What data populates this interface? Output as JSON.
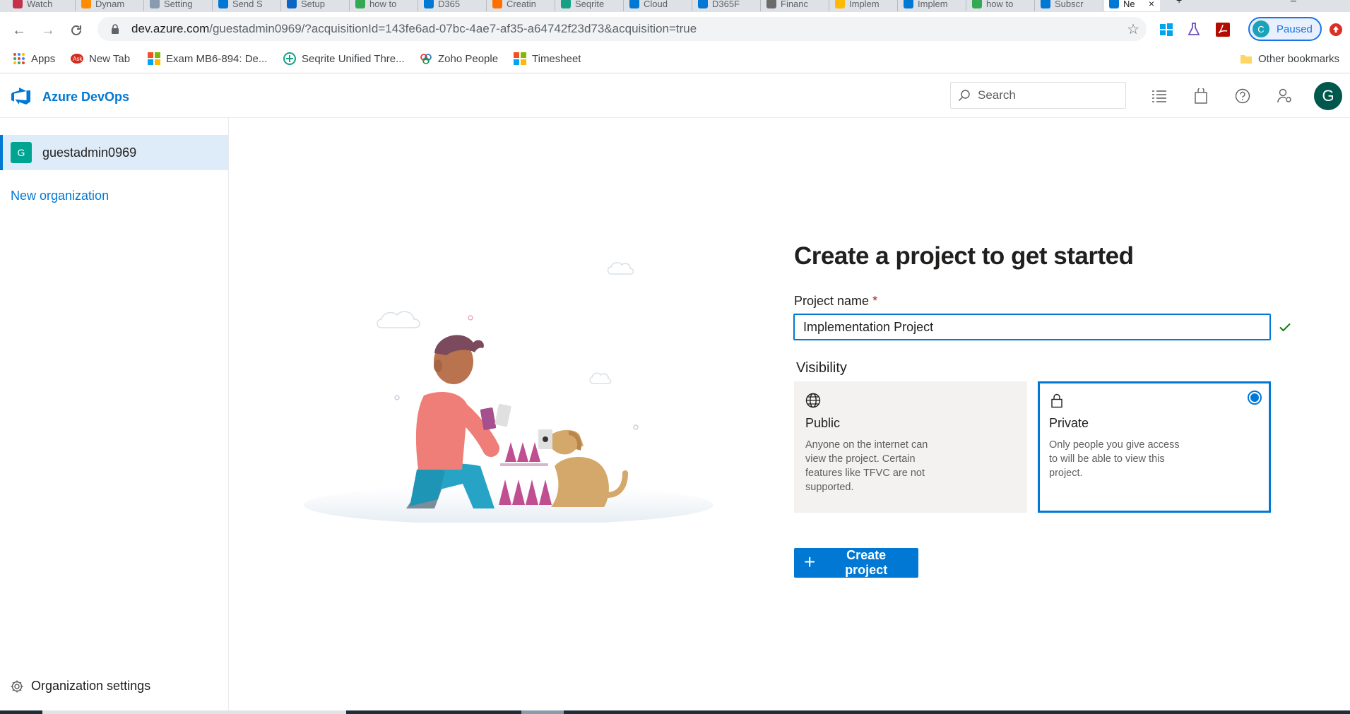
{
  "browser": {
    "tabs": [
      {
        "label": "Watch",
        "color": "#c4314b"
      },
      {
        "label": "Dynam",
        "color": "#ff8c00"
      },
      {
        "label": "Setting",
        "color": "#8a9bb0"
      },
      {
        "label": "Send S",
        "color": "#0078d4"
      },
      {
        "label": "Setup",
        "color": "#0a66c2"
      },
      {
        "label": "how to",
        "color": "#34a853"
      },
      {
        "label": "D365",
        "color": "#0078d4"
      },
      {
        "label": "Creatin",
        "color": "#ff6f00"
      },
      {
        "label": "Seqrite",
        "color": "#16a085"
      },
      {
        "label": "Cloud",
        "color": "#0078d4"
      },
      {
        "label": "D365F",
        "color": "#0078d4"
      },
      {
        "label": "Financ",
        "color": "#6b6b6b"
      },
      {
        "label": "Implem",
        "color": "#ffb900"
      },
      {
        "label": "Implem",
        "color": "#0078d4"
      },
      {
        "label": "how to",
        "color": "#34a853"
      },
      {
        "label": "Subscr",
        "color": "#0078d4"
      },
      {
        "label": "Ne",
        "color": "#0078d4"
      }
    ],
    "url_host": "dev.azure.com",
    "url_path": "/guestadmin0969/?acquisitionId=143fe6ad-07bc-4ae7-af35-a64742f23d73&acquisition=true",
    "profile_initial": "C",
    "profile_status": "Paused",
    "bookmarks": [
      {
        "label": "Apps"
      },
      {
        "label": "New Tab"
      },
      {
        "label": "Exam MB6-894: De..."
      },
      {
        "label": "Seqrite Unified Thre..."
      },
      {
        "label": "Zoho People"
      },
      {
        "label": "Timesheet"
      }
    ],
    "other_bookmarks": "Other bookmarks"
  },
  "header": {
    "brand": "Azure DevOps",
    "search_placeholder": "Search",
    "user_initial": "G"
  },
  "sidebar": {
    "org_initial": "G",
    "org_name": "guestadmin0969",
    "new_org": "New organization",
    "settings": "Organization settings"
  },
  "main": {
    "title": "Create a project to get started",
    "project_name_label": "Project name",
    "required_mark": "*",
    "project_name_value": "Implementation Project",
    "visibility_label": "Visibility",
    "public": {
      "title": "Public",
      "description": "Anyone on the internet can view the project. Certain features like TFVC are not supported."
    },
    "private": {
      "title": "Private",
      "description": "Only people you give access to will be able to view this project.",
      "selected": true
    },
    "create_button": "Create project"
  },
  "colors": {
    "accent": "#0078d4",
    "selected_bg": "#deecf9",
    "org_badge": "#00a591",
    "avatar": "#00574b"
  }
}
